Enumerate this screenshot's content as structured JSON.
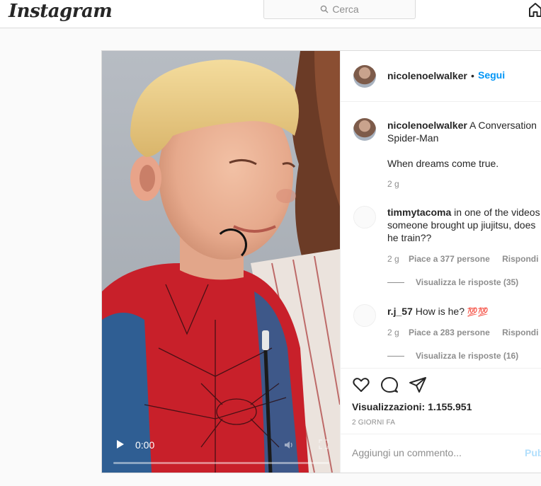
{
  "header": {
    "logo_text": "Instagram",
    "search_placeholder": "Cerca"
  },
  "video": {
    "time": "0:00",
    "progress": 0
  },
  "post_header": {
    "username": "nicolenoelwalker",
    "separator": "•",
    "follow_label": "Segui"
  },
  "caption": {
    "username": "nicolenoelwalker",
    "text_line1": "A Conversation",
    "text_line2": "Spider-Man",
    "text_line3": "When dreams come true.",
    "time": "2 g"
  },
  "comments": [
    {
      "username": "timmytacoma",
      "text_line1": "in one of the videos",
      "text_line2": "someone brought up jiujitsu, does",
      "text_line3": "he train??",
      "time": "2 g",
      "likes": "Piace a 377 persone",
      "reply_label": "Rispondi",
      "view_replies": "Visualizza le risposte (35)"
    },
    {
      "username": "r.j_57",
      "text": "How is he?",
      "emoji": "💯💯",
      "time": "2 g",
      "likes": "Piace a 283 persone",
      "reply_label": "Rispondi",
      "view_replies": "Visualizza le risposte (16)"
    }
  ],
  "actions": {
    "views": "Visualizzazioni: 1.155.951",
    "date": "2 GIORNI FA"
  },
  "add_comment": {
    "placeholder": "Aggiungi un commento...",
    "publish_label": "Pubblica"
  },
  "colors": {
    "accent": "#0095f6",
    "publish_disabled": "#b2dffc",
    "muted": "#8e8e8e",
    "border": "#dbdbdb"
  }
}
